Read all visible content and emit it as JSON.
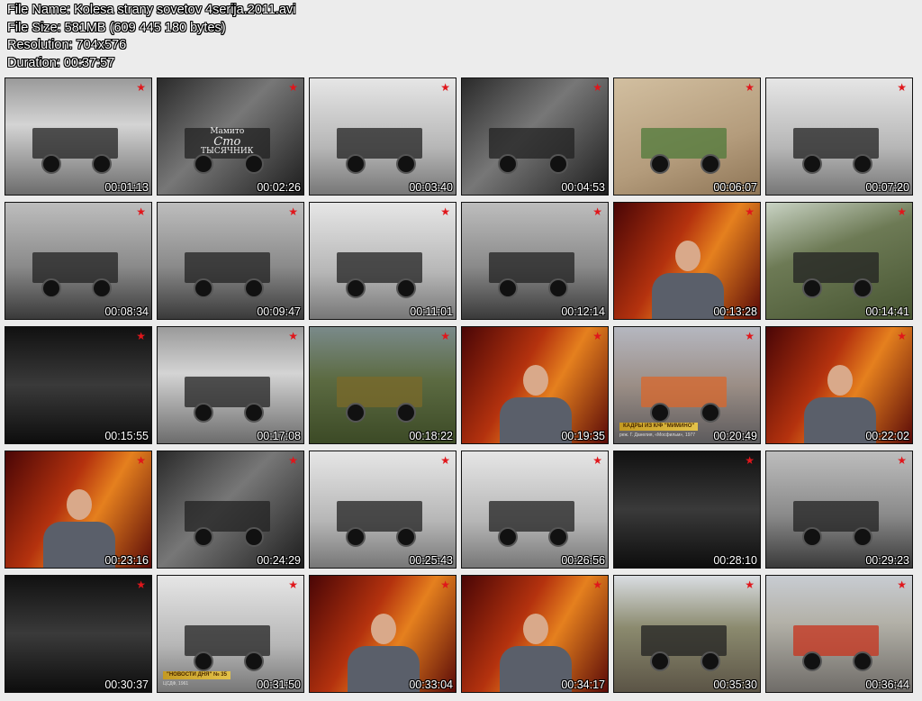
{
  "header": {
    "file_name": "File Name: Kolesa strany sovetov 4serija.2011.avi",
    "file_size": "File Size: 581MB (609 445 180 bytes)",
    "resolution": "Resolution: 704x576",
    "duration": "Duration: 00:37:57"
  },
  "thumbnails": [
    {
      "ts": "00:01:13",
      "scene": "bw-a"
    },
    {
      "ts": "00:02:26",
      "scene": "bw-d",
      "text1": "Мамито",
      "text2": "Сто",
      "text3": "ТЫСЯЧНИК"
    },
    {
      "ts": "00:03:40",
      "scene": "bw-c"
    },
    {
      "ts": "00:04:53",
      "scene": "bw-d"
    },
    {
      "ts": "00:06:07",
      "scene": "sand"
    },
    {
      "ts": "00:07:20",
      "scene": "bw-c"
    },
    {
      "ts": "00:08:34",
      "scene": "bw-b"
    },
    {
      "ts": "00:09:47",
      "scene": "bw-b"
    },
    {
      "ts": "00:11:01",
      "scene": "bw-c"
    },
    {
      "ts": "00:12:14",
      "scene": "bw-b"
    },
    {
      "ts": "00:13:28",
      "scene": "studio"
    },
    {
      "ts": "00:14:41",
      "scene": "green-cab"
    },
    {
      "ts": "00:15:55",
      "scene": "bw-e"
    },
    {
      "ts": "00:17:08",
      "scene": "bw-a"
    },
    {
      "ts": "00:18:22",
      "scene": "color-field"
    },
    {
      "ts": "00:19:35",
      "scene": "studio"
    },
    {
      "ts": "00:20:49",
      "scene": "color-street",
      "caption": "КАДРЫ ИЗ К/Ф \"МИМИНО\"",
      "caption2": "реж. Г. Данелия, «Мосфильм», 1977"
    },
    {
      "ts": "00:22:02",
      "scene": "studio"
    },
    {
      "ts": "00:23:16",
      "scene": "studio"
    },
    {
      "ts": "00:24:29",
      "scene": "bw-d"
    },
    {
      "ts": "00:25:43",
      "scene": "bw-c"
    },
    {
      "ts": "00:26:56",
      "scene": "bw-c"
    },
    {
      "ts": "00:28:10",
      "scene": "bw-e"
    },
    {
      "ts": "00:29:23",
      "scene": "bw-b"
    },
    {
      "ts": "00:30:37",
      "scene": "bw-e"
    },
    {
      "ts": "00:31:50",
      "scene": "bw-c",
      "caption": "\"НОВОСТИ ДНЯ\" № 35",
      "caption2": "ЦСДФ, 1961"
    },
    {
      "ts": "00:33:04",
      "scene": "studio"
    },
    {
      "ts": "00:34:17",
      "scene": "studio"
    },
    {
      "ts": "00:35:30",
      "scene": "color-quarry"
    },
    {
      "ts": "00:36:44",
      "scene": "color-red"
    }
  ],
  "star_color": "#e0161b"
}
